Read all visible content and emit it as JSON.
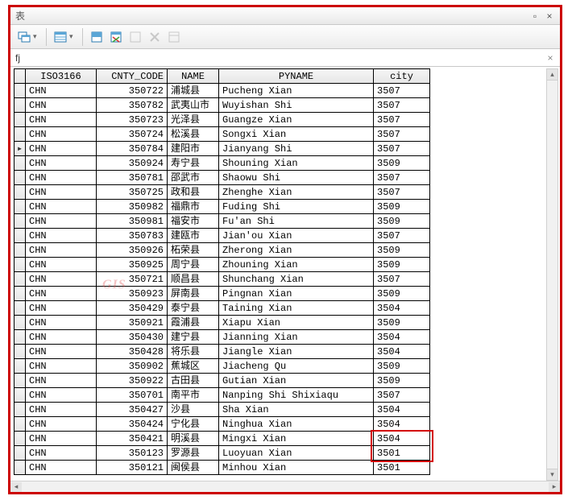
{
  "window": {
    "title": "表"
  },
  "fxbar": {
    "text": "fj"
  },
  "watermark": "GIS",
  "columns": [
    "ISO3166",
    "CNTY_CODE",
    "NAME",
    "PYNAME",
    "city"
  ],
  "current_row_index": 4,
  "highlight_rows": [
    24,
    25
  ],
  "highlight_col": "city",
  "rows": [
    {
      "iso": "CHN",
      "code": "350722",
      "name": "浦城县",
      "pyname": "Pucheng Xian",
      "city": "3507"
    },
    {
      "iso": "CHN",
      "code": "350782",
      "name": "武夷山市",
      "pyname": "Wuyishan Shi",
      "city": "3507"
    },
    {
      "iso": "CHN",
      "code": "350723",
      "name": "光泽县",
      "pyname": "Guangze Xian",
      "city": "3507"
    },
    {
      "iso": "CHN",
      "code": "350724",
      "name": "松溪县",
      "pyname": "Songxi Xian",
      "city": "3507"
    },
    {
      "iso": "CHN",
      "code": "350784",
      "name": "建阳市",
      "pyname": "Jianyang Shi",
      "city": "3507"
    },
    {
      "iso": "CHN",
      "code": "350924",
      "name": "寿宁县",
      "pyname": "Shouning Xian",
      "city": "3509"
    },
    {
      "iso": "CHN",
      "code": "350781",
      "name": "邵武市",
      "pyname": "Shaowu Shi",
      "city": "3507"
    },
    {
      "iso": "CHN",
      "code": "350725",
      "name": "政和县",
      "pyname": "Zhenghe Xian",
      "city": "3507"
    },
    {
      "iso": "CHN",
      "code": "350982",
      "name": "福鼎市",
      "pyname": "Fuding Shi",
      "city": "3509"
    },
    {
      "iso": "CHN",
      "code": "350981",
      "name": "福安市",
      "pyname": "Fu'an Shi",
      "city": "3509"
    },
    {
      "iso": "CHN",
      "code": "350783",
      "name": "建瓯市",
      "pyname": "Jian'ou Xian",
      "city": "3507"
    },
    {
      "iso": "CHN",
      "code": "350926",
      "name": "柘荣县",
      "pyname": "Zherong Xian",
      "city": "3509"
    },
    {
      "iso": "CHN",
      "code": "350925",
      "name": "周宁县",
      "pyname": "Zhouning Xian",
      "city": "3509"
    },
    {
      "iso": "CHN",
      "code": "350721",
      "name": "顺昌县",
      "pyname": "Shunchang Xian",
      "city": "3507"
    },
    {
      "iso": "CHN",
      "code": "350923",
      "name": "屏南县",
      "pyname": "Pingnan Xian",
      "city": "3509"
    },
    {
      "iso": "CHN",
      "code": "350429",
      "name": "泰宁县",
      "pyname": "Taining Xian",
      "city": "3504"
    },
    {
      "iso": "CHN",
      "code": "350921",
      "name": "霞浦县",
      "pyname": "Xiapu Xian",
      "city": "3509"
    },
    {
      "iso": "CHN",
      "code": "350430",
      "name": "建宁县",
      "pyname": "Jianning Xian",
      "city": "3504"
    },
    {
      "iso": "CHN",
      "code": "350428",
      "name": "将乐县",
      "pyname": "Jiangle Xian",
      "city": "3504"
    },
    {
      "iso": "CHN",
      "code": "350902",
      "name": "蕉城区",
      "pyname": "Jiacheng Qu",
      "city": "3509"
    },
    {
      "iso": "CHN",
      "code": "350922",
      "name": "古田县",
      "pyname": "Gutian Xian",
      "city": "3509"
    },
    {
      "iso": "CHN",
      "code": "350701",
      "name": "南平市",
      "pyname": "Nanping Shi Shixiaqu",
      "city": "3507"
    },
    {
      "iso": "CHN",
      "code": "350427",
      "name": "沙县",
      "pyname": "Sha Xian",
      "city": "3504"
    },
    {
      "iso": "CHN",
      "code": "350424",
      "name": "宁化县",
      "pyname": "Ninghua Xian",
      "city": "3504"
    },
    {
      "iso": "CHN",
      "code": "350421",
      "name": "明溪县",
      "pyname": "Mingxi Xian",
      "city": "3504"
    },
    {
      "iso": "CHN",
      "code": "350123",
      "name": "罗源县",
      "pyname": "Luoyuan Xian",
      "city": "3501"
    },
    {
      "iso": "CHN",
      "code": "350121",
      "name": "闽侯县",
      "pyname": "Minhou Xian",
      "city": "3501"
    }
  ]
}
